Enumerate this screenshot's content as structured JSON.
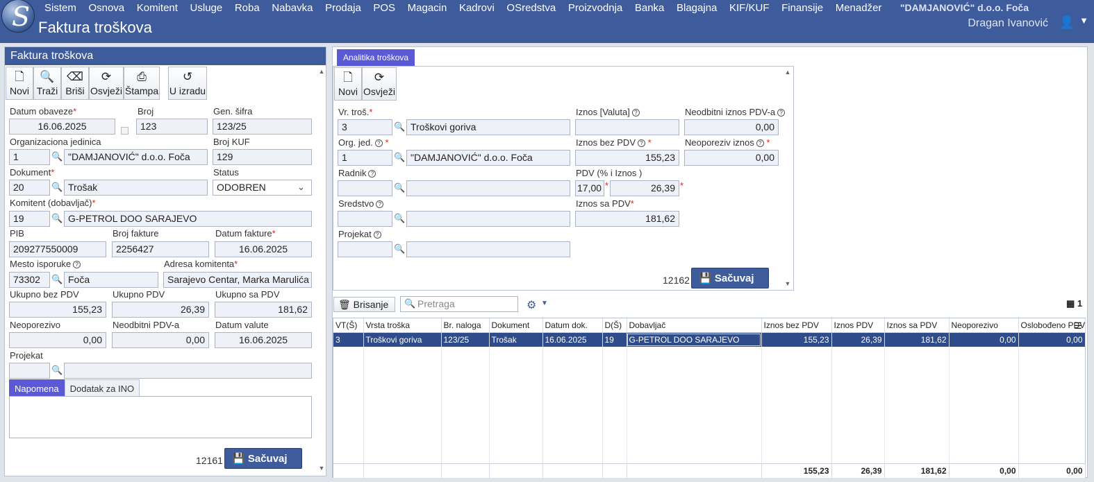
{
  "app": {
    "logo_letter": "S",
    "title": "Faktura troškova",
    "company": "\"DAMJANOVIĆ\" d.o.o. Foča",
    "user": "Dragan Ivanović"
  },
  "menu": [
    "Sistem",
    "Osnova",
    "Komitent",
    "Usluge",
    "Roba",
    "Nabavka",
    "Prodaja",
    "POS",
    "Magacin",
    "Kadrovi",
    "OSredstva",
    "Proizvodnja",
    "Banka",
    "Blagajna",
    "KIF/KUF",
    "Finansije",
    "Menadžer"
  ],
  "left": {
    "title": "Faktura troškova",
    "toolbar": {
      "novi": "Novi",
      "trazi": "Traži",
      "brisi": "Briši",
      "osvjezi": "Osvježi",
      "stampa": "Štampa",
      "u_izradu": "U izradu"
    },
    "labels": {
      "datum_obaveze": "Datum obaveze",
      "broj": "Broj",
      "gen_sifra": "Gen. šifra",
      "org_jed": "Organizaciona jedinica",
      "broj_kuf": "Broj KUF",
      "dokument": "Dokument",
      "status": "Status",
      "komitent": "Komitent (dobavljač)",
      "pib": "PIB",
      "broj_fakture": "Broj fakture",
      "datum_fakture": "Datum fakture",
      "mesto": "Mesto isporuke",
      "adresa": "Adresa komitenta",
      "ukupno_bez": "Ukupno bez PDV",
      "ukupno_pdv": "Ukupno PDV",
      "ukupno_sa": "Ukupno sa PDV",
      "neoporezivo": "Neoporezivo",
      "neodbitni": "Neodbitni PDV-a",
      "datum_valute": "Datum valute",
      "projekat": "Projekat"
    },
    "values": {
      "datum_obaveze": "16.06.2025",
      "broj": "123",
      "gen_sifra": "123/25",
      "org_id": "1",
      "org_name": "\"DAMJANOVIĆ\" d.o.o. Foča",
      "broj_kuf": "129",
      "dok_id": "20",
      "dok_name": "Trošak",
      "status": "ODOBREN",
      "kom_id": "19",
      "kom_name": "G-PETROL DOO SARAJEVO",
      "pib": "209277550009",
      "broj_fakture": "2256427",
      "datum_fakture": "16.06.2025",
      "mesto_id": "73302",
      "mesto_name": "Foča",
      "adresa": "Sarajevo Centar, Marka Marulića",
      "ukupno_bez": "155,23",
      "ukupno_pdv": "26,39",
      "ukupno_sa": "181,62",
      "neoporezivo": "0,00",
      "neodbitni": "0,00",
      "datum_valute": "16.06.2025",
      "proj_id": "",
      "proj_name": ""
    },
    "tabs": [
      "Napomena",
      "Dodatak za INO"
    ],
    "record_no": "12161",
    "save": "Sačuvaj"
  },
  "right": {
    "tab": "Analitika troškova",
    "toolbar": {
      "novi": "Novi",
      "osvjezi": "Osvježi"
    },
    "labels": {
      "vr_tros": "Vr. troš.",
      "iznos_valuta": "Iznos [Valuta]",
      "neodbitni": "Neodbitni iznos PDV-a",
      "org_jed": "Org. jed.",
      "iznos_bez": "Iznos bez PDV",
      "neoporeziv": "Neoporeziv iznos",
      "radnik": "Radnik",
      "pdv": "PDV (% i Iznos )",
      "sredstvo": "Sredstvo",
      "iznos_sa": "Iznos sa PDV",
      "projekat": "Projekat"
    },
    "values": {
      "vr_id": "3",
      "vr_name": "Troškovi goriva",
      "iznos_valuta": "",
      "neodbitni": "0,00",
      "org_id": "1",
      "org_name": "\"DAMJANOVIĆ\" d.o.o. Foča",
      "iznos_bez": "155,23",
      "neoporeziv": "0,00",
      "pdv_pct": "17,00",
      "pdv_iznos": "26,39",
      "iznos_sa": "181,62"
    },
    "record_no": "12162",
    "save": "Sačuvaj"
  },
  "grid": {
    "delete": "Brisanje",
    "search_placeholder": "Pretraga",
    "count": "1",
    "columns": [
      "VT(Š)",
      "Vrsta troška",
      "Br. naloga",
      "Dokument",
      "Datum dok.",
      "D(Š)",
      "Dobavljač",
      "Iznos bez PDV",
      "Iznos PDV",
      "Iznos sa PDV",
      "Neoporezivo",
      "Oslobođeno PDV"
    ],
    "rows": [
      [
        "3",
        "Troškovi goriva",
        "123/25",
        "Trošak",
        "16.06.2025",
        "19",
        "G-PETROL DOO SARAJEVO",
        "155,23",
        "26,39",
        "181,62",
        "0,00",
        "0,00"
      ]
    ],
    "totals": [
      "",
      "",
      "",
      "",
      "",
      "",
      "",
      "155,23",
      "26,39",
      "181,62",
      "0,00",
      "0,00"
    ]
  }
}
